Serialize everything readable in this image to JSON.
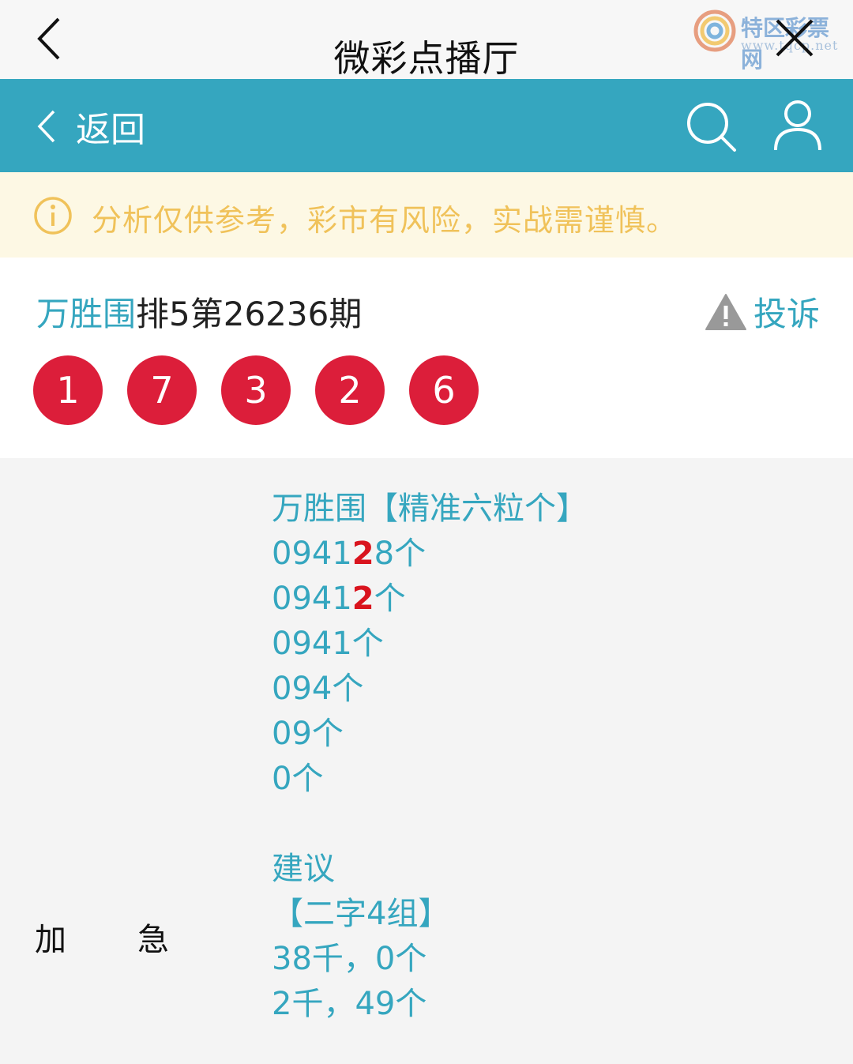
{
  "titlebar": {
    "title": "微彩点播厅"
  },
  "watermark": {
    "name": "特区彩票网",
    "url": "www.tqcp.net"
  },
  "navbar": {
    "back_label": "返回"
  },
  "notice": {
    "text": "分析仅供参考，彩市有风险，实战需谨慎。"
  },
  "issue": {
    "author": "万胜围",
    "title_rest": "排5第26236期",
    "complain_label": "投诉",
    "balls": [
      "1",
      "7",
      "3",
      "2",
      "6"
    ]
  },
  "content": {
    "side_label_1": "加",
    "side_label_2": "急",
    "heading": "万胜围【精准六粒个】",
    "line1_a": "0941",
    "line1_b": "2",
    "line1_c": "8个",
    "line2_a": "0941",
    "line2_b": "2",
    "line2_c": "个",
    "line3": "0941个",
    "line4": "094个",
    "line5": "09个",
    "line6": "0个",
    "advice_title": "建议",
    "advice_sub": "【二字4组】",
    "advice1": "38千，0个",
    "advice2": "2千，49个"
  },
  "colors": {
    "accent": "#35a6bf",
    "ball": "#dc1e3a",
    "highlight": "#d9141e",
    "notice": "#f0c25a"
  }
}
